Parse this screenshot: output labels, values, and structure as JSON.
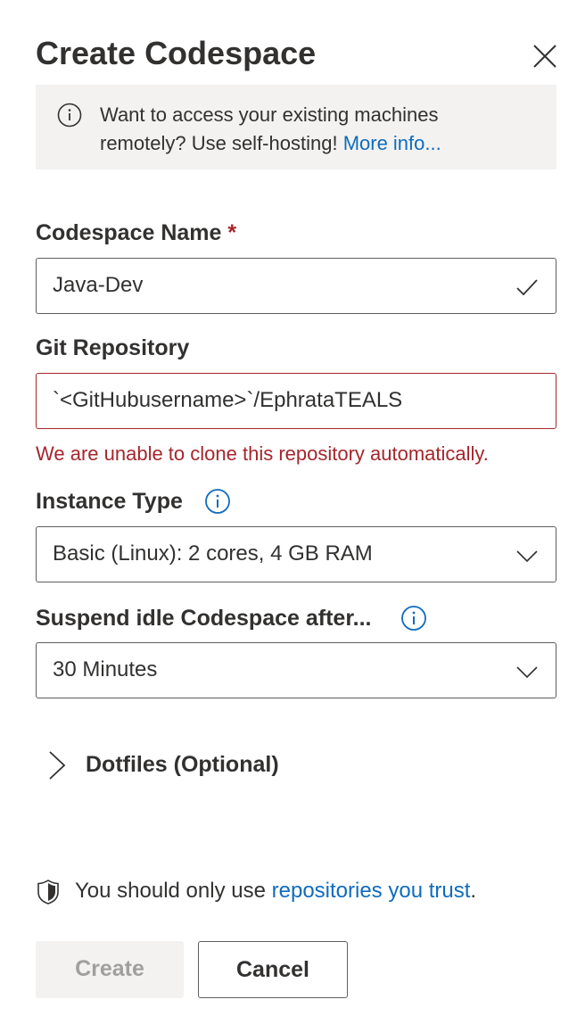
{
  "dialog": {
    "title": "Create Codespace",
    "close_icon": "close-icon"
  },
  "banner": {
    "text": "Want to access your existing machines remotely? Use self-hosting!",
    "link": "More info..."
  },
  "codespace_name": {
    "label": "Codespace Name",
    "required_marker": "*",
    "value": "Java-Dev"
  },
  "git_repository": {
    "label": "Git Repository",
    "value": "`<GitHubusername>`/EphrataTEALS",
    "error": "We are unable to clone this repository automatically."
  },
  "instance_type": {
    "label": "Instance Type",
    "value": "Basic (Linux): 2 cores, 4 GB RAM"
  },
  "suspend_idle": {
    "label": "Suspend idle Codespace after...",
    "value": "30 Minutes"
  },
  "dotfiles": {
    "label": "Dotfiles (Optional)"
  },
  "trust": {
    "text": "You should only use",
    "link": "repositories you trust",
    "suffix": "."
  },
  "buttons": {
    "create": "Create",
    "cancel": "Cancel"
  },
  "colors": {
    "error": "#a4262c",
    "link": "#0f6cbd",
    "banner_bg": "#f3f2f1"
  }
}
